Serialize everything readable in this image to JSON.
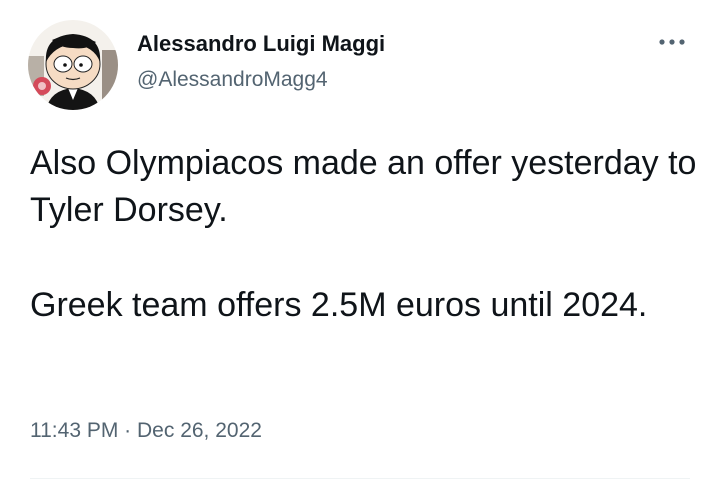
{
  "author": {
    "display_name": "Alessandro Luigi Maggi",
    "handle": "@AlessandroMagg4",
    "avatar_icon": "cartoon-character-avatar-icon"
  },
  "menu": {
    "icon": "more-options-icon"
  },
  "tweet": {
    "paragraphs": [
      "Also Olympiacos made an offer yesterday to Tyler Dorsey.",
      "Greek team offers 2.5M euros until 2024."
    ],
    "time": "11:43 PM",
    "separator": "·",
    "date": "Dec 26, 2022"
  },
  "colors": {
    "text_primary": "#0f1419",
    "text_secondary": "#536471",
    "divider": "#eff3f4"
  }
}
